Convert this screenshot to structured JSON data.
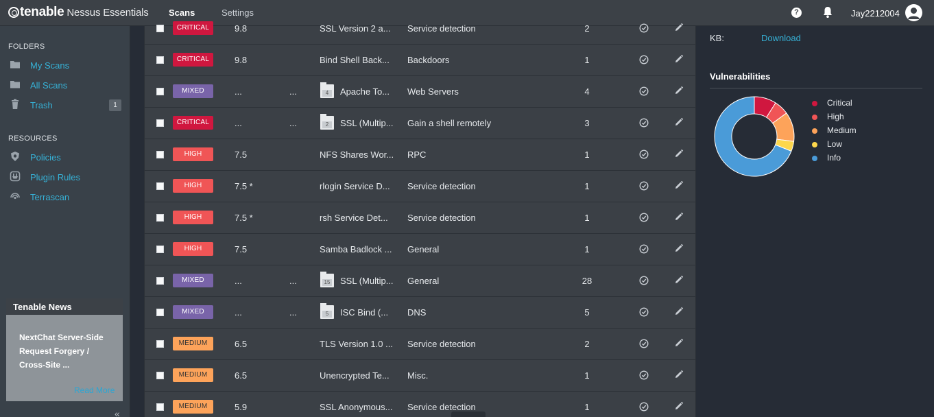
{
  "app": {
    "brand": "tenable",
    "product": "Nessus Essentials",
    "nav": {
      "scans": "Scans",
      "settings": "Settings"
    },
    "user": "Jay2212004"
  },
  "sidebar": {
    "folders_heading": "FOLDERS",
    "folders": [
      {
        "label": "My Scans",
        "icon": "folder-icon"
      },
      {
        "label": "All Scans",
        "icon": "folder-icon"
      },
      {
        "label": "Trash",
        "icon": "trash-icon",
        "count": "1"
      }
    ],
    "resources_heading": "RESOURCES",
    "resources": [
      {
        "label": "Policies",
        "icon": "shield-icon"
      },
      {
        "label": "Plugin Rules",
        "icon": "plugin-rules-icon"
      },
      {
        "label": "Terrascan",
        "icon": "terrascan-icon"
      }
    ],
    "news": {
      "title": "Tenable News",
      "body": "NextChat Server-Side Request Forgery / Cross-Site ...",
      "more": "Read More"
    }
  },
  "vulnerabilities": [
    {
      "severity": "CRITICAL",
      "sev_class": "critical",
      "cvss": "9.8",
      "vpr": "",
      "group_count": "",
      "name": "SSL Version 2 a...",
      "family": "Service detection",
      "count": "2"
    },
    {
      "severity": "CRITICAL",
      "sev_class": "critical",
      "cvss": "9.8",
      "vpr": "",
      "group_count": "",
      "name": "Bind Shell Back...",
      "family": "Backdoors",
      "count": "1"
    },
    {
      "severity": "MIXED",
      "sev_class": "mixed",
      "cvss": "...",
      "vpr": "...",
      "group_count": "4",
      "name": "Apache To...",
      "family": "Web Servers",
      "count": "4"
    },
    {
      "severity": "CRITICAL",
      "sev_class": "critical",
      "cvss": "...",
      "vpr": "...",
      "group_count": "2",
      "name": "SSL (Multip...",
      "family": "Gain a shell remotely",
      "count": "3"
    },
    {
      "severity": "HIGH",
      "sev_class": "high",
      "cvss": "7.5",
      "vpr": "",
      "group_count": "",
      "name": "NFS Shares Wor...",
      "family": "RPC",
      "count": "1"
    },
    {
      "severity": "HIGH",
      "sev_class": "high",
      "cvss": "7.5 *",
      "vpr": "",
      "group_count": "",
      "name": "rlogin Service D...",
      "family": "Service detection",
      "count": "1"
    },
    {
      "severity": "HIGH",
      "sev_class": "high",
      "cvss": "7.5 *",
      "vpr": "",
      "group_count": "",
      "name": "rsh Service Det...",
      "family": "Service detection",
      "count": "1"
    },
    {
      "severity": "HIGH",
      "sev_class": "high",
      "cvss": "7.5",
      "vpr": "",
      "group_count": "",
      "name": "Samba Badlock ...",
      "family": "General",
      "count": "1"
    },
    {
      "severity": "MIXED",
      "sev_class": "mixed",
      "cvss": "...",
      "vpr": "...",
      "group_count": "15",
      "name": "SSL (Multip...",
      "family": "General",
      "count": "28"
    },
    {
      "severity": "MIXED",
      "sev_class": "mixed",
      "cvss": "...",
      "vpr": "...",
      "group_count": "5",
      "name": "ISC Bind (...",
      "family": "DNS",
      "count": "5"
    },
    {
      "severity": "MEDIUM",
      "sev_class": "medium",
      "cvss": "6.5",
      "vpr": "",
      "group_count": "",
      "name": "TLS Version 1.0 ...",
      "family": "Service detection",
      "count": "2"
    },
    {
      "severity": "MEDIUM",
      "sev_class": "medium",
      "cvss": "6.5",
      "vpr": "",
      "group_count": "",
      "name": "Unencrypted Te...",
      "family": "Misc.",
      "count": "1"
    },
    {
      "severity": "MEDIUM",
      "sev_class": "medium",
      "cvss": "5.9",
      "vpr": "",
      "group_count": "",
      "name": "SSL Anonymous...",
      "family": "Service detection",
      "count": "1"
    }
  ],
  "details": {
    "kb_label": "KB:",
    "kb_link": "Download",
    "vuln_title": "Vulnerabilities"
  },
  "chart_data": {
    "type": "pie",
    "title": "Vulnerabilities",
    "categories": [
      "Critical",
      "High",
      "Medium",
      "Low",
      "Info"
    ],
    "values": [
      9,
      6,
      12,
      4,
      69
    ],
    "colors": [
      "#d0173f",
      "#f05556",
      "#fda35a",
      "#fdd74c",
      "#4a9bd8"
    ],
    "legend": "right"
  }
}
